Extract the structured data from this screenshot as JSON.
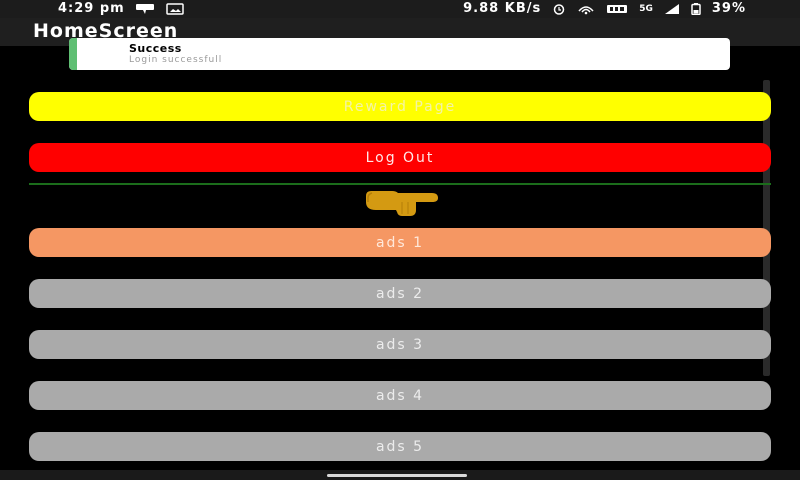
{
  "status_bar": {
    "time": "4:29 pm",
    "network_speed": "9.88 KB/s",
    "network_type": "5G",
    "battery": "39%"
  },
  "app_bar": {
    "title": "HomeScreen"
  },
  "toast": {
    "title": "Success",
    "message": "Login successfull",
    "accent_color": "#5fbf73"
  },
  "buttons": {
    "reward": "Reward Page",
    "logout": "Log Out",
    "ads": [
      "ads 1",
      "ads 2",
      "ads 3",
      "ads 4",
      "ads 5"
    ]
  },
  "colors": {
    "reward": "#ffff00",
    "logout": "#ff0000",
    "ads_active": "#f59763",
    "ads_inactive": "#aaaaaa",
    "divider": "#1b6d1b",
    "hand": "#d49a12"
  },
  "icons": {
    "hand": "pointing-hand-icon"
  }
}
